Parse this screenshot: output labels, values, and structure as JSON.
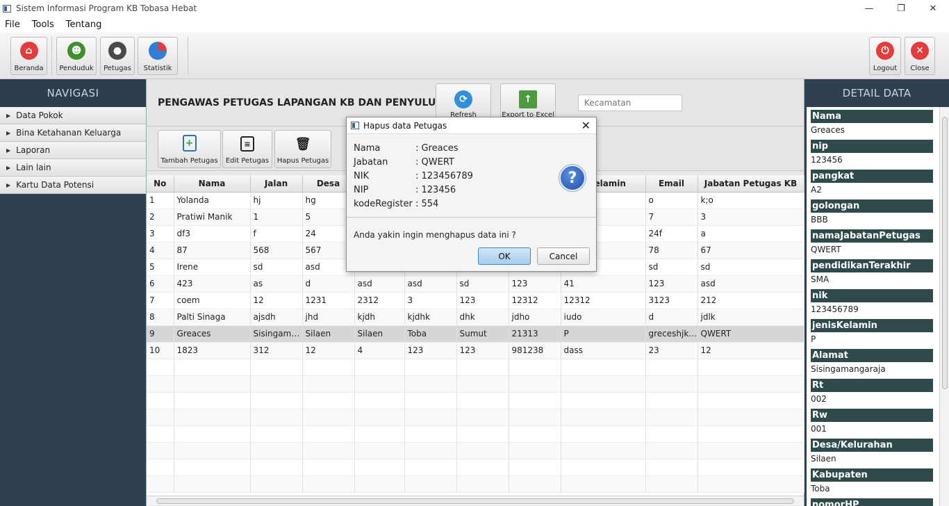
{
  "window": {
    "title": "Sistem Informasi Program KB Tobasa Hebat",
    "minimize": "—",
    "maximize": "❐",
    "close": "✕"
  },
  "menu": [
    "File",
    "Tools",
    "Tentang"
  ],
  "toolbar": {
    "beranda": "Beranda",
    "penduduk": "Penduduk",
    "petugas": "Petugas",
    "statistik": "Statistik",
    "logout": "Logout",
    "close": "Close"
  },
  "navigation": {
    "title": "NAVIGASI",
    "items": [
      "Data Pokok",
      "Bina Ketahanan Keluarga",
      "Laporan",
      "Lain lain",
      "Kartu Data Potensi"
    ]
  },
  "main": {
    "page_title": "PENGAWAS PETUGAS LAPANGAN KB DAN PENYULUH",
    "refresh": "Refresh",
    "export": "Export to Excel",
    "search_placeholder": "Kecamatan",
    "tambah": "Tambah Petugas",
    "edit": "Edit Petugas",
    "hapus": "Hapus Petugas"
  },
  "table": {
    "columns": [
      "No",
      "Nama",
      "Jalan",
      "Desa",
      "",
      "",
      "",
      "",
      "s Kelamin",
      "Email",
      "Jabatan Petugas KB"
    ],
    "rows": [
      [
        "1",
        "Yolanda",
        "hj",
        "hg",
        "",
        "",
        "",
        "",
        "",
        "o",
        "k;o"
      ],
      [
        "2",
        "Pratiwi Manik",
        "1",
        "5",
        "",
        "",
        "",
        "",
        "",
        "7",
        "3"
      ],
      [
        "3",
        "df3",
        "f",
        "24",
        "",
        "",
        "",
        "",
        "",
        "24f",
        "a"
      ],
      [
        "4",
        "87",
        "568",
        "567",
        "",
        "",
        "",
        "",
        "",
        "78",
        "67"
      ],
      [
        "5",
        "Irene",
        "sd",
        "asd",
        "",
        "",
        "",
        "",
        "",
        "sd",
        "sd"
      ],
      [
        "6",
        "423",
        "as",
        "d",
        "asd",
        "asd",
        "sd",
        "123",
        "41",
        "123",
        "asd"
      ],
      [
        "7",
        "coem",
        "12",
        "1231",
        "2312",
        "3",
        "123",
        "12312",
        "12312",
        "3123",
        "212"
      ],
      [
        "8",
        "Palti Sinaga",
        "ajsdh",
        "jhd",
        "kjdh",
        "kjdhk",
        "dhk",
        "jdho",
        "iudo",
        "d",
        "jdlk"
      ],
      [
        "9",
        "Greaces",
        "Sisingamangaraja",
        "Silaen",
        "Silaen",
        "Toba",
        "Sumut",
        "21313",
        "P",
        "greceshjkl@gmail.com",
        "QWERT"
      ],
      [
        "10",
        "1823",
        "312",
        "12",
        "4",
        "123",
        "123",
        "981238",
        "dass",
        "23",
        "12"
      ]
    ],
    "selected_row": 9
  },
  "detail": {
    "title": "DETAIL DATA",
    "fields": [
      {
        "label": "Nama",
        "value": "Greaces"
      },
      {
        "label": "nip",
        "value": "123456"
      },
      {
        "label": "pangkat",
        "value": "A2"
      },
      {
        "label": "golongan",
        "value": "BBB"
      },
      {
        "label": "namaJabatanPetugas",
        "value": "QWERT"
      },
      {
        "label": "pendidikanTerakhir",
        "value": "SMA"
      },
      {
        "label": "nik",
        "value": "123456789"
      },
      {
        "label": "jenisKelamin",
        "value": "P"
      },
      {
        "label": "Alamat",
        "value": "Sisingamangaraja"
      },
      {
        "label": "Rt",
        "value": "002"
      },
      {
        "label": "Rw",
        "value": "001"
      },
      {
        "label": "Desa/Kelurahan",
        "value": "Silaen"
      },
      {
        "label": "Kabupaten",
        "value": "Toba"
      },
      {
        "label": "nomorHP",
        "value": ""
      }
    ]
  },
  "dialog": {
    "title": "Hapus data Petugas",
    "close": "✕",
    "lines": [
      {
        "key": "Nama",
        "value": ": Greaces"
      },
      {
        "key": "Jabatan",
        "value": ": QWERT"
      },
      {
        "key": "NIK",
        "value": ": 123456789"
      },
      {
        "key": "NIP",
        "value": ": 123456"
      },
      {
        "key": "kodeRegister",
        "value": ": 554"
      }
    ],
    "question": "Anda yakin ingin menghapus data ini ?",
    "ok": "OK",
    "cancel": "Cancel",
    "help_glyph": "?"
  }
}
